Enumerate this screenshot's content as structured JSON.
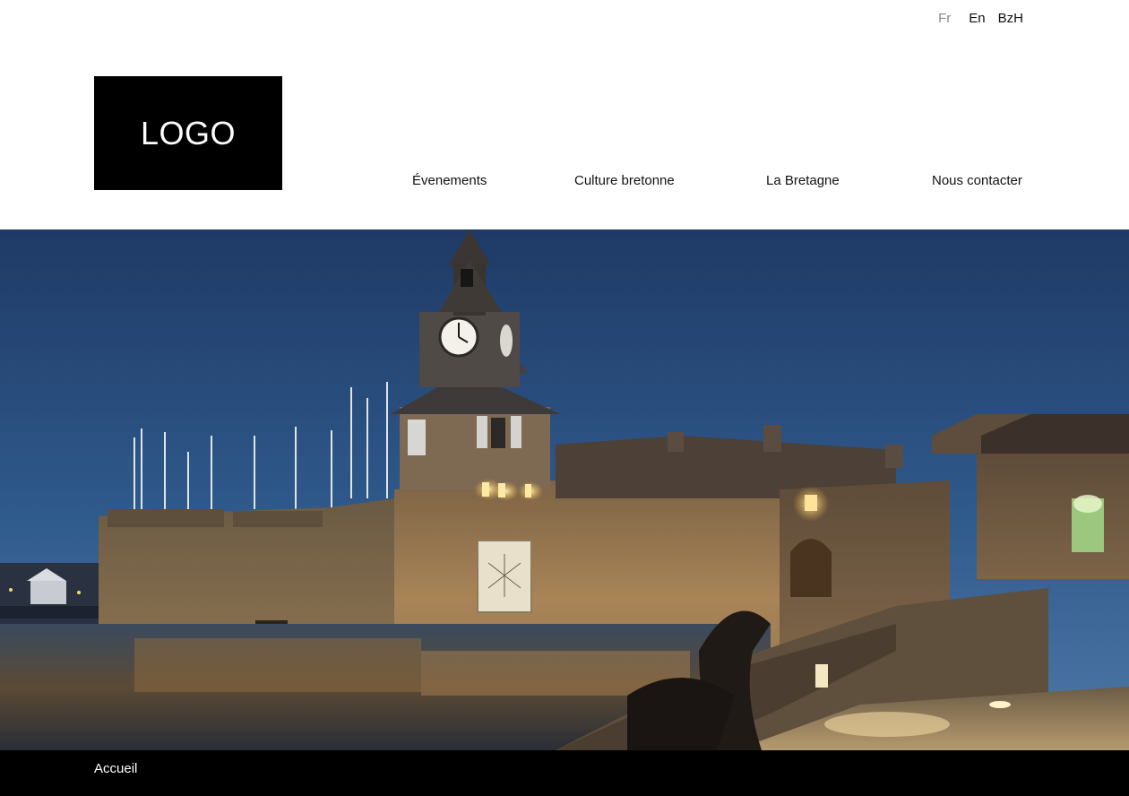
{
  "languages": {
    "fr": "Fr",
    "en": "En",
    "bzh": "BzH",
    "active": "Fr"
  },
  "logo": {
    "text": "LOGO"
  },
  "nav": {
    "items": [
      {
        "label": "Évenements"
      },
      {
        "label": "Culture bretonne"
      },
      {
        "label": "La Bretagne"
      },
      {
        "label": "Nous contacter"
      }
    ]
  },
  "hero": {
    "image": "photo-night-fortified-town-clock-tower"
  },
  "footer": {
    "breadcrumb": "Accueil"
  },
  "colors": {
    "background": "#ffffff",
    "logo_bg": "#000000",
    "footer_bg": "#000000",
    "active_lang": "#8a8a8a"
  }
}
